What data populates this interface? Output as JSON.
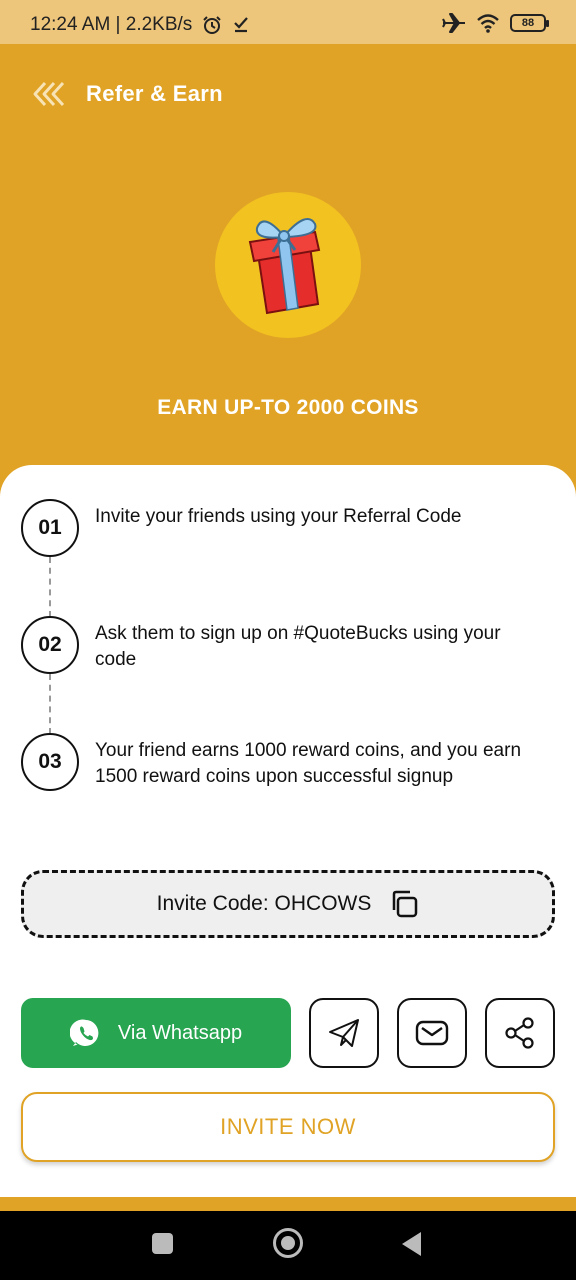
{
  "status_bar": {
    "time": "12:24 AM | 2.2KB/s",
    "battery": "88"
  },
  "header": {
    "title": "Refer & Earn"
  },
  "hero": {
    "title": "EARN UP-TO 2000 COINS"
  },
  "steps": [
    {
      "number": "01",
      "text": "Invite your friends using your Referral Code"
    },
    {
      "number": "02",
      "text": "Ask them to sign up on #QuoteBucks using your code"
    },
    {
      "number": "03",
      "text": "Your friend earns 1000 reward coins, and you earn 1500 reward coins upon successful signup"
    }
  ],
  "invite_code": {
    "label": "Invite Code: OHCOWS"
  },
  "share": {
    "whatsapp_label": "Via Whatsapp"
  },
  "invite_now": {
    "label": "INVITE NOW"
  },
  "colors": {
    "primary": "#e0a325",
    "status_bar": "#edc57b",
    "whatsapp": "#27a551",
    "gift_circle": "#f2c220"
  }
}
